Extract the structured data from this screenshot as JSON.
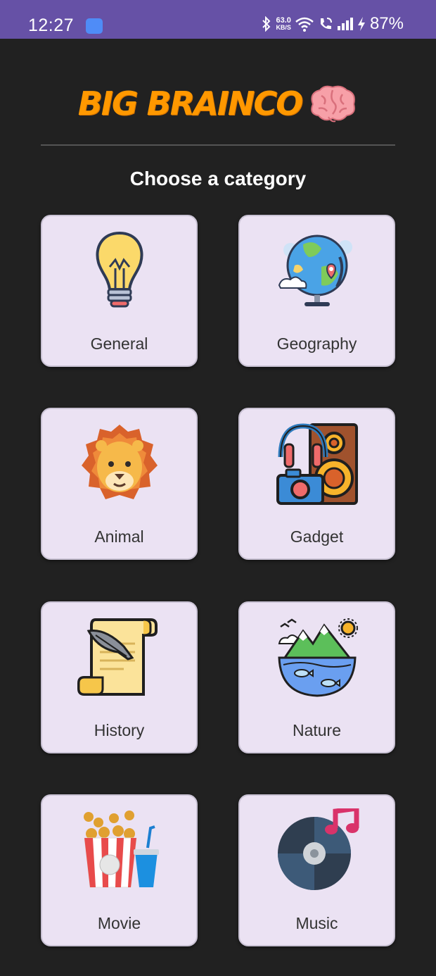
{
  "status_bar": {
    "time": "12:27",
    "net_speed_value": "63.0",
    "net_speed_unit": "KB/S",
    "battery": "87%",
    "icons": [
      "android-app-icon",
      "bluetooth-icon",
      "wifi-icon",
      "wifi-call-icon",
      "signal-icon",
      "charging-icon"
    ]
  },
  "header": {
    "title": "BIG BRAINCO",
    "title_icon": "brain-icon",
    "title_color": "#ff9800",
    "subtitle": "Choose a category"
  },
  "categories": [
    {
      "label": "General",
      "icon": "lightbulb-icon"
    },
    {
      "label": "Geography",
      "icon": "globe-icon"
    },
    {
      "label": "Animal",
      "icon": "lion-icon"
    },
    {
      "label": "Gadget",
      "icon": "gadget-icon"
    },
    {
      "label": "History",
      "icon": "scroll-icon"
    },
    {
      "label": "Nature",
      "icon": "nature-icon"
    },
    {
      "label": "Movie",
      "icon": "popcorn-icon"
    },
    {
      "label": "Music",
      "icon": "vinyl-record-icon"
    }
  ],
  "colors": {
    "status_bar": "#6651a6",
    "background": "#212121",
    "card": "#ebe2f3"
  }
}
